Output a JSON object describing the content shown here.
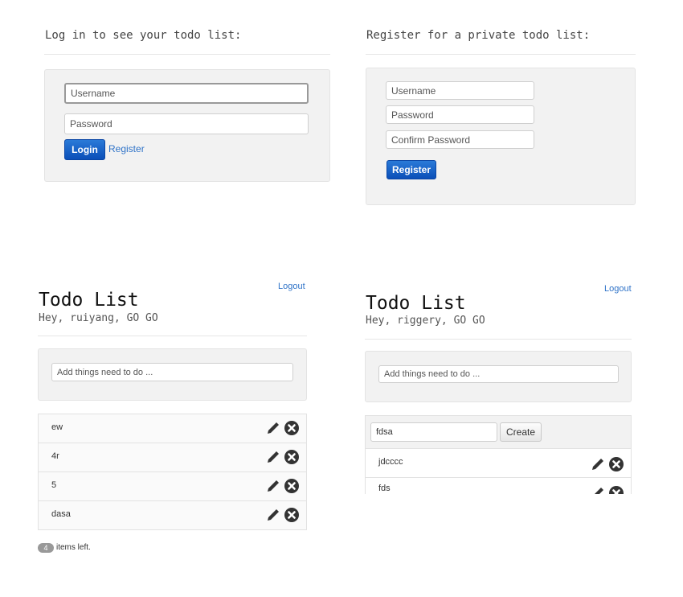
{
  "login": {
    "heading": "Log in to see your todo list:",
    "username_placeholder": "Username",
    "password_placeholder": "Password",
    "login_label": "Login",
    "register_link": "Register"
  },
  "register": {
    "heading": "Register for a private todo list:",
    "username_placeholder": "Username",
    "password_placeholder": "Password",
    "confirm_placeholder": "Confirm Password",
    "register_label": "Register"
  },
  "todo_left": {
    "logout": "Logout",
    "title": "Todo List",
    "greeting": "Hey, ruiyang, GO GO",
    "add_placeholder": "Add things need to do ...",
    "items": [
      "ew",
      "4r",
      "5",
      "dasa"
    ],
    "count": "4",
    "items_left_label": "items left."
  },
  "todo_right": {
    "logout": "Logout",
    "title": "Todo List",
    "greeting": "Hey, riggery, GO GO",
    "add_placeholder": "Add things need to do ...",
    "edit_value": "fdsa",
    "create_label": "Create",
    "items": [
      "jdcccc",
      "fds"
    ]
  },
  "icons": {
    "edit": "pencil-icon",
    "delete": "close-circle-icon"
  },
  "colors": {
    "primary": "#0b4fb8",
    "link": "#2f73c8",
    "well": "#f2f2f2",
    "icon": "#333333"
  }
}
